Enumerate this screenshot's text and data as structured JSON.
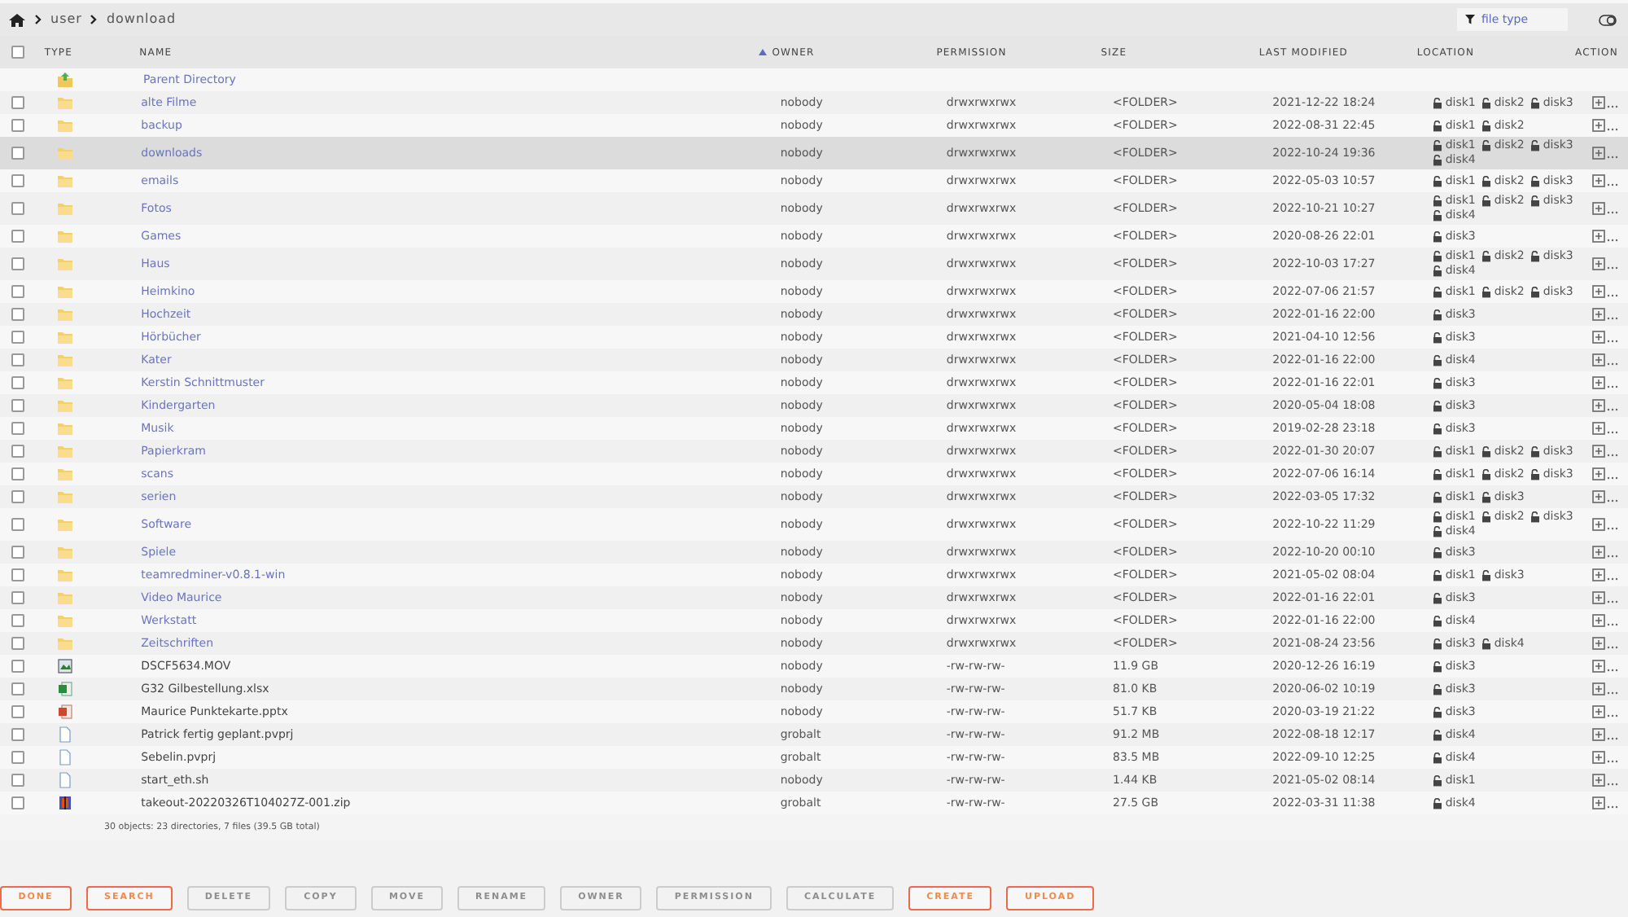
{
  "breadcrumb": [
    "user",
    "download"
  ],
  "filter": {
    "placeholder": "file type"
  },
  "select_all": {
    "checked": false
  },
  "columns": [
    {
      "label": "TYPE",
      "sorted": false
    },
    {
      "label": "NAME",
      "sorted": true
    },
    {
      "label": "OWNER",
      "sorted": false
    },
    {
      "label": "PERMISSION",
      "sorted": false
    },
    {
      "label": "SIZE",
      "sorted": false
    },
    {
      "label": "LAST MODIFIED",
      "sorted": false
    },
    {
      "label": "LOCATION",
      "sorted": false
    },
    {
      "label": "ACTION",
      "sorted": false
    }
  ],
  "parent": {
    "name": "Parent Directory"
  },
  "rows": [
    {
      "kind": "folder",
      "name": "alte Filme",
      "owner": "nobody",
      "permission": "drwxrwxrwx",
      "size": "<FOLDER>",
      "modified": "2021-12-22 18:24",
      "location": [
        "disk1",
        "disk2",
        "disk3"
      ],
      "hovered": false,
      "checked": false
    },
    {
      "kind": "folder",
      "name": "backup",
      "owner": "nobody",
      "permission": "drwxrwxrwx",
      "size": "<FOLDER>",
      "modified": "2022-08-31 22:45",
      "location": [
        "disk1",
        "disk2"
      ],
      "hovered": false,
      "checked": false
    },
    {
      "kind": "folder",
      "name": "downloads",
      "owner": "nobody",
      "permission": "drwxrwxrwx",
      "size": "<FOLDER>",
      "modified": "2022-10-24 19:36",
      "location": [
        "disk1",
        "disk2",
        "disk3",
        "disk4"
      ],
      "hovered": true,
      "checked": false
    },
    {
      "kind": "folder",
      "name": "emails",
      "owner": "nobody",
      "permission": "drwxrwxrwx",
      "size": "<FOLDER>",
      "modified": "2022-05-03 10:57",
      "location": [
        "disk1",
        "disk2",
        "disk3"
      ],
      "hovered": false,
      "checked": false
    },
    {
      "kind": "folder",
      "name": "Fotos",
      "owner": "nobody",
      "permission": "drwxrwxrwx",
      "size": "<FOLDER>",
      "modified": "2022-10-21 10:27",
      "location": [
        "disk1",
        "disk2",
        "disk3",
        "disk4"
      ],
      "hovered": false,
      "checked": false
    },
    {
      "kind": "folder",
      "name": "Games",
      "owner": "nobody",
      "permission": "drwxrwxrwx",
      "size": "<FOLDER>",
      "modified": "2020-08-26 22:01",
      "location": [
        "disk3"
      ],
      "hovered": false,
      "checked": false
    },
    {
      "kind": "folder",
      "name": "Haus",
      "owner": "nobody",
      "permission": "drwxrwxrwx",
      "size": "<FOLDER>",
      "modified": "2022-10-03 17:27",
      "location": [
        "disk1",
        "disk2",
        "disk3",
        "disk4"
      ],
      "hovered": false,
      "checked": false
    },
    {
      "kind": "folder",
      "name": "Heimkino",
      "owner": "nobody",
      "permission": "drwxrwxrwx",
      "size": "<FOLDER>",
      "modified": "2022-07-06 21:57",
      "location": [
        "disk1",
        "disk2",
        "disk3"
      ],
      "hovered": false,
      "checked": false
    },
    {
      "kind": "folder",
      "name": "Hochzeit",
      "owner": "nobody",
      "permission": "drwxrwxrwx",
      "size": "<FOLDER>",
      "modified": "2022-01-16 22:00",
      "location": [
        "disk3"
      ],
      "hovered": false,
      "checked": false
    },
    {
      "kind": "folder",
      "name": "Hörbücher",
      "owner": "nobody",
      "permission": "drwxrwxrwx",
      "size": "<FOLDER>",
      "modified": "2021-04-10 12:56",
      "location": [
        "disk3"
      ],
      "hovered": false,
      "checked": false
    },
    {
      "kind": "folder",
      "name": "Kater",
      "owner": "nobody",
      "permission": "drwxrwxrwx",
      "size": "<FOLDER>",
      "modified": "2022-01-16 22:00",
      "location": [
        "disk4"
      ],
      "hovered": false,
      "checked": false
    },
    {
      "kind": "folder",
      "name": "Kerstin Schnittmuster",
      "owner": "nobody",
      "permission": "drwxrwxrwx",
      "size": "<FOLDER>",
      "modified": "2022-01-16 22:01",
      "location": [
        "disk3"
      ],
      "hovered": false,
      "checked": false
    },
    {
      "kind": "folder",
      "name": "Kindergarten",
      "owner": "nobody",
      "permission": "drwxrwxrwx",
      "size": "<FOLDER>",
      "modified": "2020-05-04 18:08",
      "location": [
        "disk3"
      ],
      "hovered": false,
      "checked": false
    },
    {
      "kind": "folder",
      "name": "Musik",
      "owner": "nobody",
      "permission": "drwxrwxrwx",
      "size": "<FOLDER>",
      "modified": "2019-02-28 23:18",
      "location": [
        "disk3"
      ],
      "hovered": false,
      "checked": false
    },
    {
      "kind": "folder",
      "name": "Papierkram",
      "owner": "nobody",
      "permission": "drwxrwxrwx",
      "size": "<FOLDER>",
      "modified": "2022-01-30 20:07",
      "location": [
        "disk1",
        "disk2",
        "disk3"
      ],
      "hovered": false,
      "checked": false
    },
    {
      "kind": "folder",
      "name": "scans",
      "owner": "nobody",
      "permission": "drwxrwxrwx",
      "size": "<FOLDER>",
      "modified": "2022-07-06 16:14",
      "location": [
        "disk1",
        "disk2",
        "disk3"
      ],
      "hovered": false,
      "checked": false
    },
    {
      "kind": "folder",
      "name": "serien",
      "owner": "nobody",
      "permission": "drwxrwxrwx",
      "size": "<FOLDER>",
      "modified": "2022-03-05 17:32",
      "location": [
        "disk1",
        "disk3"
      ],
      "hovered": false,
      "checked": false
    },
    {
      "kind": "folder",
      "name": "Software",
      "owner": "nobody",
      "permission": "drwxrwxrwx",
      "size": "<FOLDER>",
      "modified": "2022-10-22 11:29",
      "location": [
        "disk1",
        "disk2",
        "disk3",
        "disk4"
      ],
      "hovered": false,
      "checked": false
    },
    {
      "kind": "folder",
      "name": "Spiele",
      "owner": "nobody",
      "permission": "drwxrwxrwx",
      "size": "<FOLDER>",
      "modified": "2022-10-20 00:10",
      "location": [
        "disk3"
      ],
      "hovered": false,
      "checked": false
    },
    {
      "kind": "folder",
      "name": "teamredminer-v0.8.1-win",
      "owner": "nobody",
      "permission": "drwxrwxrwx",
      "size": "<FOLDER>",
      "modified": "2021-05-02 08:04",
      "location": [
        "disk1",
        "disk3"
      ],
      "hovered": false,
      "checked": false
    },
    {
      "kind": "folder",
      "name": "Video Maurice",
      "owner": "nobody",
      "permission": "drwxrwxrwx",
      "size": "<FOLDER>",
      "modified": "2022-01-16 22:01",
      "location": [
        "disk3"
      ],
      "hovered": false,
      "checked": false
    },
    {
      "kind": "folder",
      "name": "Werkstatt",
      "owner": "nobody",
      "permission": "drwxrwxrwx",
      "size": "<FOLDER>",
      "modified": "2022-01-16 22:00",
      "location": [
        "disk4"
      ],
      "hovered": false,
      "checked": false
    },
    {
      "kind": "folder",
      "name": "Zeitschriften",
      "owner": "nobody",
      "permission": "drwxrwxrwx",
      "size": "<FOLDER>",
      "modified": "2021-08-24 23:56",
      "location": [
        "disk3",
        "disk4"
      ],
      "hovered": false,
      "checked": false
    },
    {
      "kind": "video",
      "name": "DSCF5634.MOV",
      "owner": "nobody",
      "permission": "-rw-rw-rw-",
      "size": "11.9 GB",
      "modified": "2020-12-26 16:19",
      "location": [
        "disk3"
      ],
      "hovered": false,
      "checked": false
    },
    {
      "kind": "spreadsheet",
      "name": "G32 Gilbestellung.xlsx",
      "owner": "nobody",
      "permission": "-rw-rw-rw-",
      "size": "81.0 KB",
      "modified": "2020-06-02 10:19",
      "location": [
        "disk3"
      ],
      "hovered": false,
      "checked": false
    },
    {
      "kind": "presentation",
      "name": "Maurice Punktekarte.pptx",
      "owner": "nobody",
      "permission": "-rw-rw-rw-",
      "size": "51.7 KB",
      "modified": "2020-03-19 21:22",
      "location": [
        "disk3"
      ],
      "hovered": false,
      "checked": false
    },
    {
      "kind": "file",
      "name": "Patrick fertig geplant.pvprj",
      "owner": "grobalt",
      "permission": "-rw-rw-rw-",
      "size": "91.2 MB",
      "modified": "2022-08-18 12:17",
      "location": [
        "disk4"
      ],
      "hovered": false,
      "checked": false
    },
    {
      "kind": "file",
      "name": "Sebelin.pvprj",
      "owner": "grobalt",
      "permission": "-rw-rw-rw-",
      "size": "83.5 MB",
      "modified": "2022-09-10 12:25",
      "location": [
        "disk4"
      ],
      "hovered": false,
      "checked": false
    },
    {
      "kind": "file",
      "name": "start_eth.sh",
      "owner": "nobody",
      "permission": "-rw-rw-rw-",
      "size": "1.44 KB",
      "modified": "2021-05-02 08:14",
      "location": [
        "disk1"
      ],
      "hovered": false,
      "checked": false
    },
    {
      "kind": "archive",
      "name": "takeout-20220326T104027Z-001.zip",
      "owner": "grobalt",
      "permission": "-rw-rw-rw-",
      "size": "27.5 GB",
      "modified": "2022-03-31 11:38",
      "location": [
        "disk4"
      ],
      "hovered": false,
      "checked": false
    }
  ],
  "summary": "30 objects: 23 directories, 7 files (39.5 GB total)",
  "buttons": [
    {
      "label": "DONE",
      "disabled": false
    },
    {
      "label": "SEARCH",
      "disabled": false
    },
    {
      "label": "DELETE",
      "disabled": true
    },
    {
      "label": "COPY",
      "disabled": true
    },
    {
      "label": "MOVE",
      "disabled": true
    },
    {
      "label": "RENAME",
      "disabled": true
    },
    {
      "label": "OWNER",
      "disabled": true
    },
    {
      "label": "PERMISSION",
      "disabled": true
    },
    {
      "label": "CALCULATE",
      "disabled": true
    },
    {
      "label": "CREATE",
      "disabled": false
    },
    {
      "label": "UPLOAD",
      "disabled": false
    }
  ]
}
